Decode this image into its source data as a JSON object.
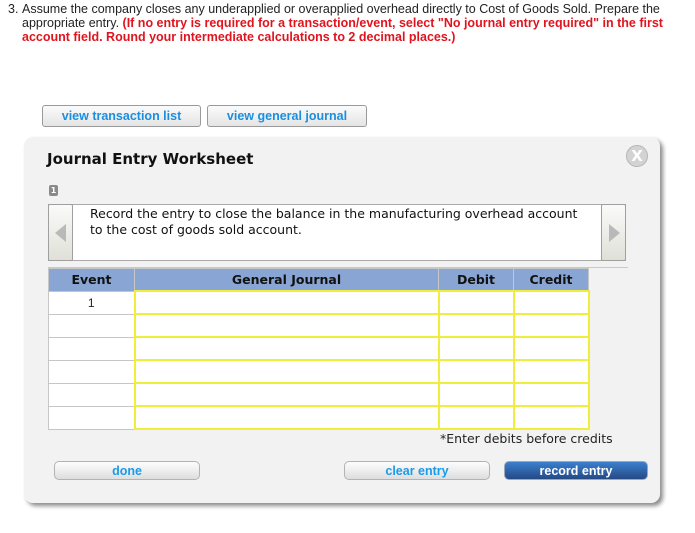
{
  "question": {
    "number": "3.",
    "text": "Assume the company closes any underapplied or overapplied overhead directly to Cost of Goods Sold. Prepare the appropriate entry. ",
    "instruction": "(If no entry is required for a transaction/event, select \"No journal entry required\" in the first account field. Round your intermediate calculations to 2 decimal places.)",
    "instruction_color": "#e0141e"
  },
  "top_buttons": {
    "view_transaction_list": "view transaction list",
    "view_general_journal": "view general journal"
  },
  "worksheet": {
    "title": "Journal Entry Worksheet",
    "close_icon": "X",
    "step_badge": "1",
    "instruction": "Record the entry to close the balance in the manufacturing overhead account to the cost of goods sold account.",
    "table": {
      "headers": [
        "Event",
        "General Journal",
        "Debit",
        "Credit"
      ],
      "header_color": "#89a5d3",
      "rows": [
        {
          "event": "1",
          "account": "",
          "debit": "",
          "credit": ""
        },
        {
          "event": "",
          "account": "",
          "debit": "",
          "credit": ""
        },
        {
          "event": "",
          "account": "",
          "debit": "",
          "credit": ""
        },
        {
          "event": "",
          "account": "",
          "debit": "",
          "credit": ""
        },
        {
          "event": "",
          "account": "",
          "debit": "",
          "credit": ""
        },
        {
          "event": "",
          "account": "",
          "debit": "",
          "credit": ""
        }
      ]
    },
    "note": "*Enter debits before credits",
    "buttons": {
      "done": "done",
      "clear_entry": "clear entry",
      "record_entry": "record entry"
    }
  }
}
